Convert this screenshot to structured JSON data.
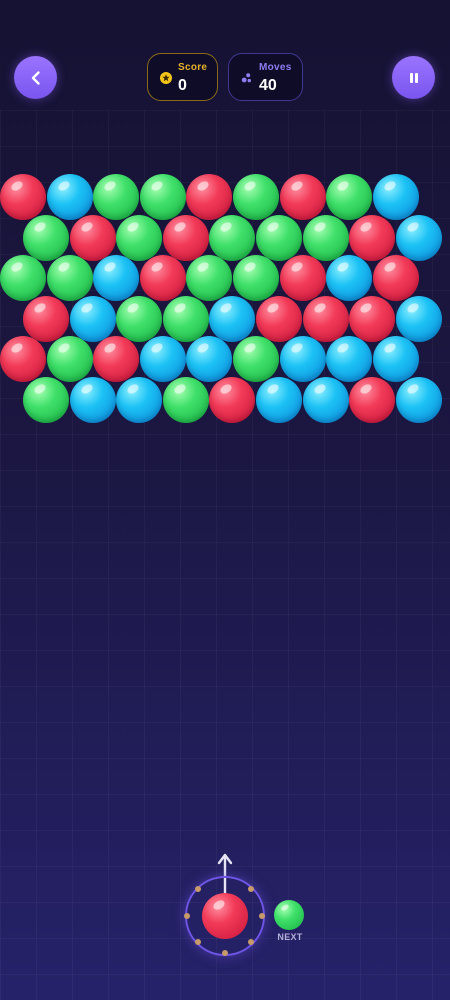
{
  "header": {
    "score_label": "Score",
    "score_value": "0",
    "moves_label": "Moves",
    "moves_value": "40"
  },
  "icons": {
    "back": "chevron-left-icon",
    "pause": "pause-icon",
    "score": "star-coin-icon",
    "moves": "bubbles-icon"
  },
  "colors": {
    "red": "#e8304f",
    "blue": "#1cb8f0",
    "green": "#37d865",
    "accent": "#8a63f8",
    "score_accent": "#e6b22a"
  },
  "board": {
    "rows": [
      [
        "red",
        "blue",
        "green",
        "green",
        "red",
        "green",
        "red",
        "green",
        "blue"
      ],
      [
        "green",
        "red",
        "green",
        "red",
        "green",
        "green",
        "green",
        "red",
        "blue"
      ],
      [
        "green",
        "green",
        "blue",
        "red",
        "green",
        "green",
        "red",
        "blue",
        "red"
      ],
      [
        "red",
        "blue",
        "green",
        "green",
        "blue",
        "red",
        "red",
        "red",
        "blue"
      ],
      [
        "red",
        "green",
        "red",
        "blue",
        "blue",
        "green",
        "blue",
        "blue",
        "blue"
      ],
      [
        "green",
        "blue",
        "blue",
        "green",
        "red",
        "blue",
        "blue",
        "red",
        "blue"
      ]
    ]
  },
  "shooter": {
    "current": "red",
    "next": "green",
    "next_label": "NEXT"
  }
}
